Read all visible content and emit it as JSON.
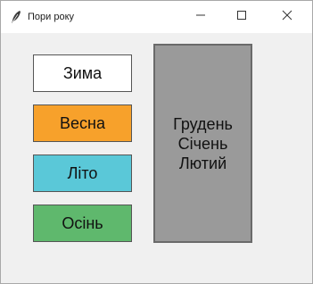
{
  "window": {
    "title": "Пори року"
  },
  "icons": {
    "app": "feather-icon",
    "minimize": "minimize-icon",
    "maximize": "maximize-icon",
    "close": "close-icon"
  },
  "seasons": [
    {
      "label": "Зима",
      "color": "#ffffff"
    },
    {
      "label": "Весна",
      "color": "#f7a12b"
    },
    {
      "label": "Літо",
      "color": "#5ac8d8"
    },
    {
      "label": "Осінь",
      "color": "#5fb86d"
    }
  ],
  "months_panel": {
    "color": "#9a9a9a",
    "months": [
      "Грудень",
      "Січень",
      "Лютий"
    ]
  }
}
